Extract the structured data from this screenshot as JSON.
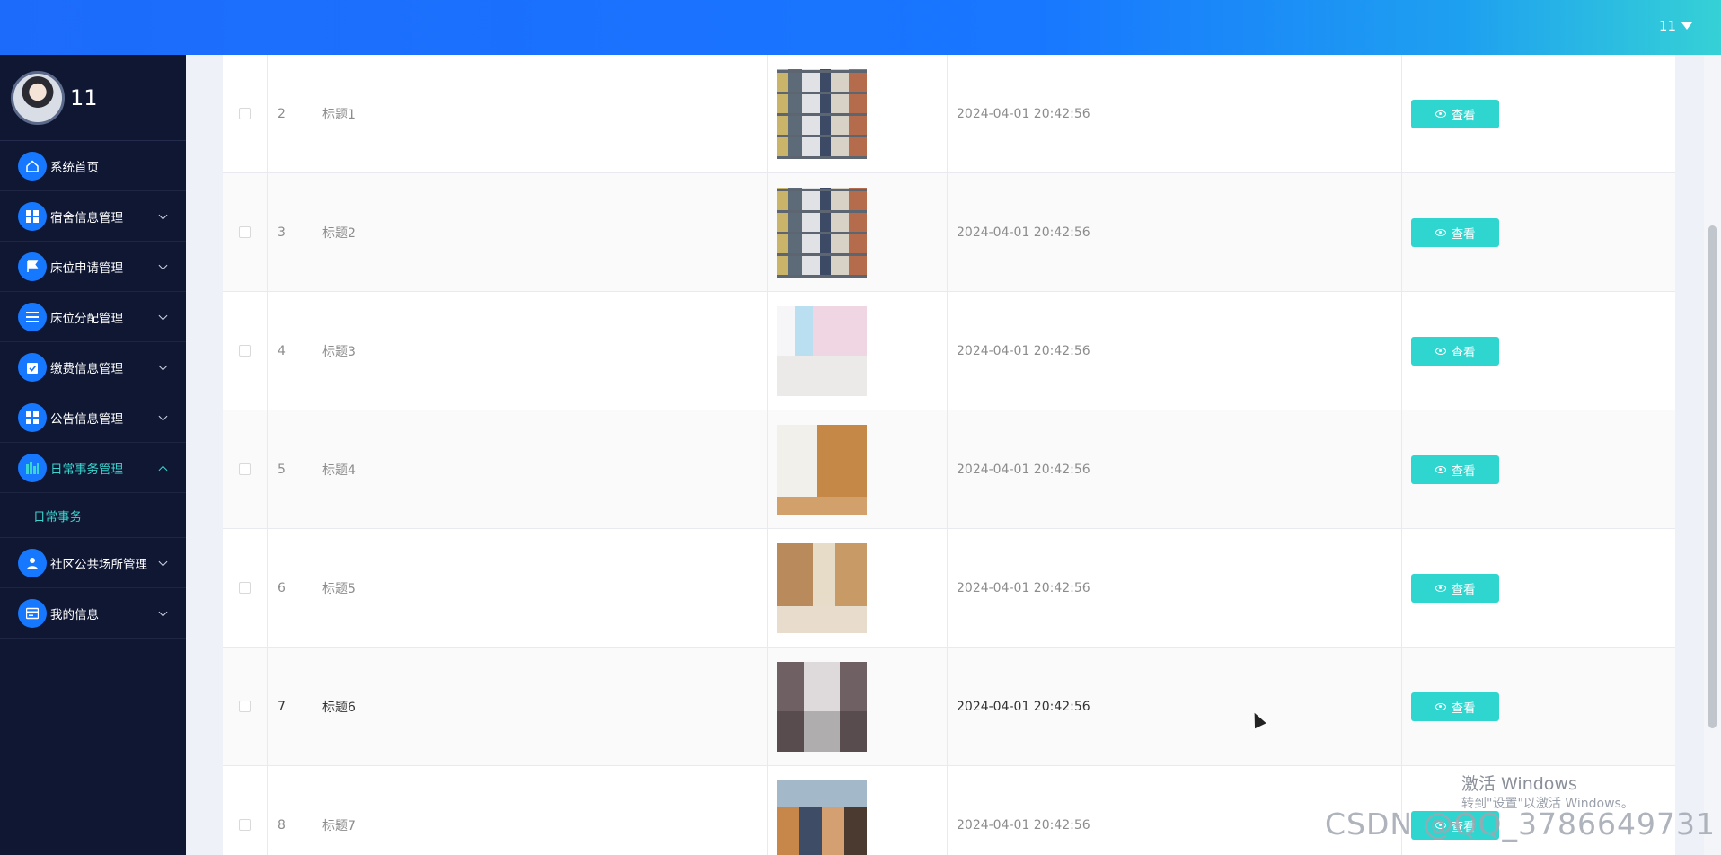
{
  "header": {
    "user_menu_label": "11"
  },
  "sidebar": {
    "username": "11",
    "items": [
      {
        "label": "系统首页",
        "icon": "home-icon"
      },
      {
        "label": "宿舍信息管理",
        "icon": "grid-icon"
      },
      {
        "label": "床位申请管理",
        "icon": "flag-icon"
      },
      {
        "label": "床位分配管理",
        "icon": "list-icon"
      },
      {
        "label": "缴费信息管理",
        "icon": "clipboard-icon"
      },
      {
        "label": "公告信息管理",
        "icon": "grid-icon"
      },
      {
        "label": "日常事务管理",
        "icon": "chart-icon",
        "expanded": true,
        "sub": [
          "日常事务"
        ]
      },
      {
        "label": "社区公共场所管理",
        "icon": "user-icon"
      },
      {
        "label": "我的信息",
        "icon": "card-icon"
      }
    ]
  },
  "table": {
    "rows": [
      {
        "index": "2",
        "title": "标题1",
        "image": "shelf",
        "time": "2024-04-01 20:42:56",
        "action": "查看"
      },
      {
        "index": "3",
        "title": "标题2",
        "image": "shelf",
        "time": "2024-04-01 20:42:56",
        "action": "查看"
      },
      {
        "index": "4",
        "title": "标题3",
        "image": "pink-dorm",
        "time": "2024-04-01 20:42:56",
        "action": "查看"
      },
      {
        "index": "5",
        "title": "标题4",
        "image": "wood-loft",
        "time": "2024-04-01 20:42:56",
        "action": "查看"
      },
      {
        "index": "6",
        "title": "标题5",
        "image": "wood-desk",
        "time": "2024-04-01 20:42:56",
        "action": "查看"
      },
      {
        "index": "7",
        "title": "标题6",
        "image": "hallway",
        "time": "2024-04-01 20:42:56",
        "action": "查看"
      },
      {
        "index": "8",
        "title": "标题7",
        "image": "dorm-room",
        "time": "2024-04-01 20:42:56",
        "action": "查看"
      }
    ]
  },
  "watermarks": {
    "windows_line1": "激活 Windows",
    "windows_line2": "转到\"设置\"以激活 Windows。",
    "csdn": "CSDN @QQ_3786649731"
  }
}
